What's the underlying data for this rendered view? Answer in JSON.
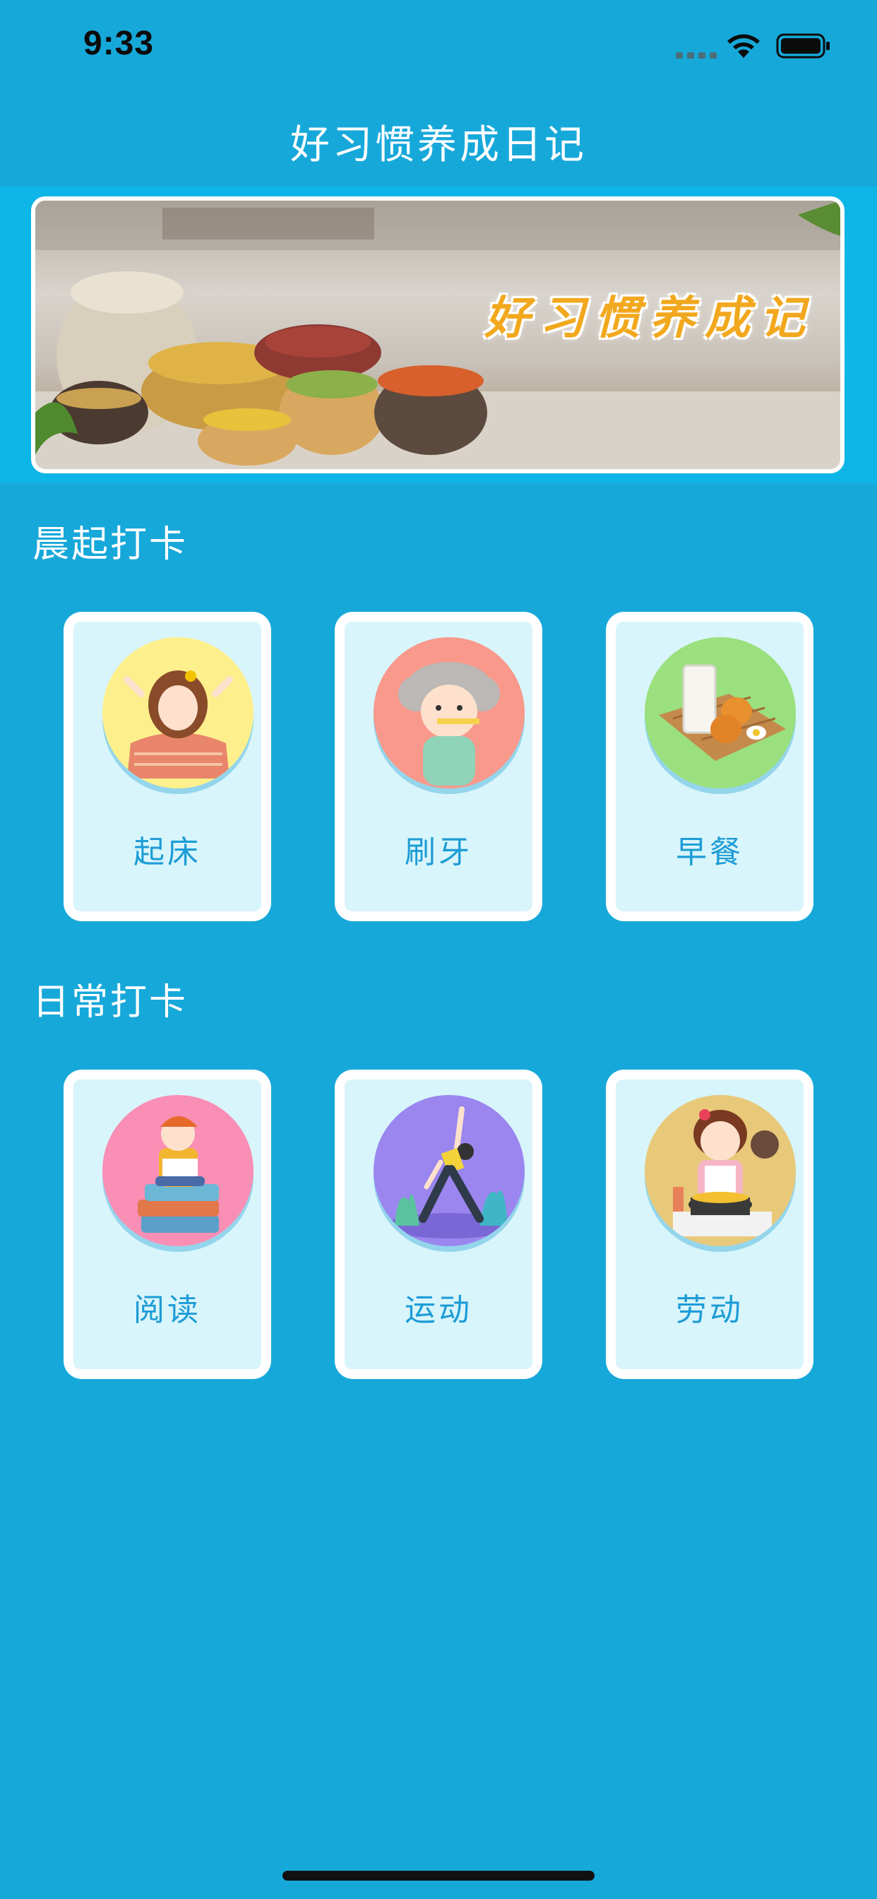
{
  "status": {
    "time": "9:33"
  },
  "nav": {
    "title": "好习惯养成日记"
  },
  "banner": {
    "overlay_text": "好习惯养成记"
  },
  "sections": [
    {
      "title": "晨起打卡",
      "items": [
        {
          "label": "起床",
          "icon": "wake-up-icon",
          "color": "#fdf08c"
        },
        {
          "label": "刷牙",
          "icon": "brush-teeth-icon",
          "color": "#f9998b"
        },
        {
          "label": "早餐",
          "icon": "breakfast-icon",
          "color": "#9be07e"
        }
      ]
    },
    {
      "title": "日常打卡",
      "items": [
        {
          "label": "阅读",
          "icon": "reading-icon",
          "color": "#f98fb5"
        },
        {
          "label": "运动",
          "icon": "exercise-icon",
          "color": "#9a86ee"
        },
        {
          "label": "劳动",
          "icon": "cooking-icon",
          "color": "#e8c97a"
        }
      ]
    }
  ],
  "colors": {
    "background": "#17a8da",
    "banner_strip": "#0db6e6",
    "card_inner": "#d8f5fb",
    "label": "#1d9cd6"
  }
}
